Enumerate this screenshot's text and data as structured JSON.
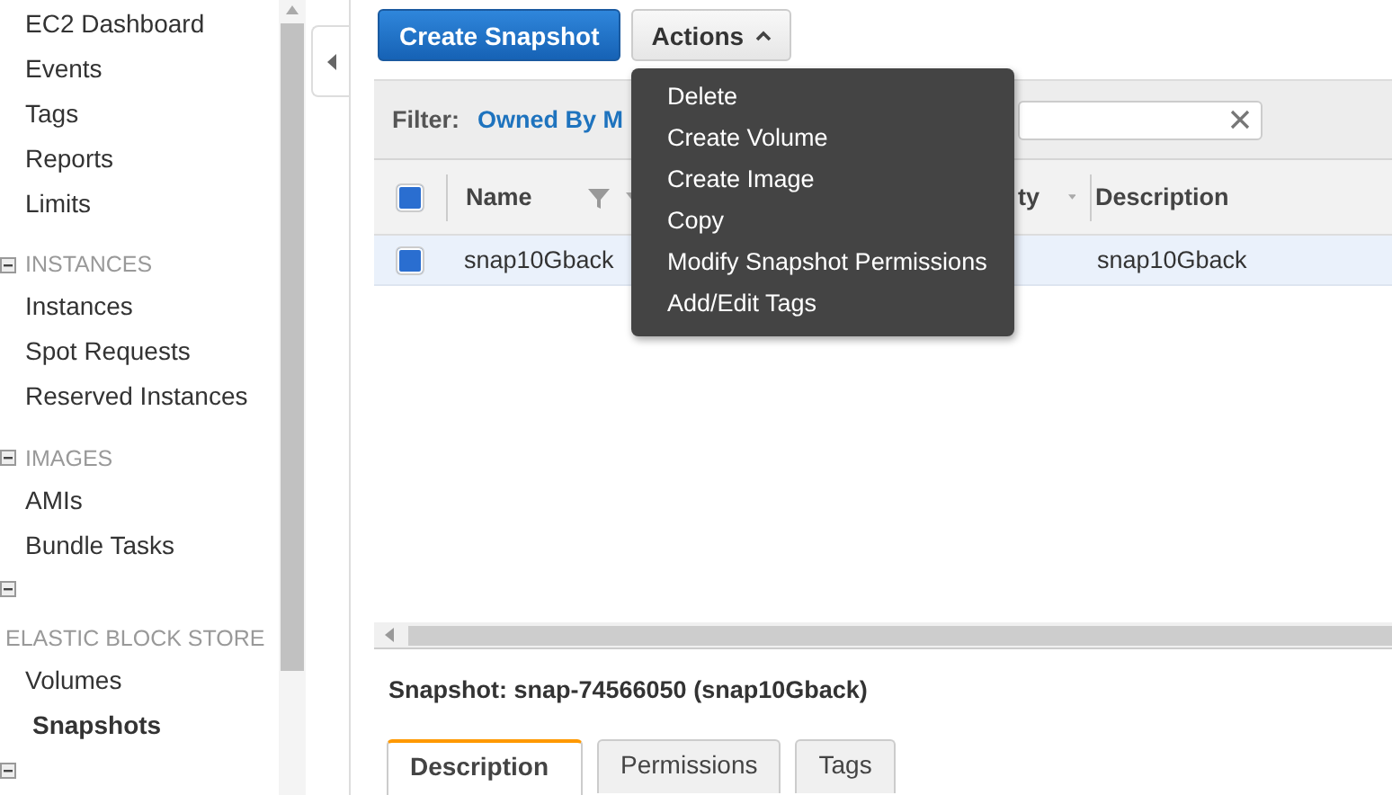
{
  "sidebar": {
    "entries": [
      {
        "kind": "link",
        "label": "EC2 Dashboard",
        "selected": false
      },
      {
        "kind": "link",
        "label": "Events",
        "selected": false
      },
      {
        "kind": "link",
        "label": "Tags",
        "selected": false
      },
      {
        "kind": "link",
        "label": "Reports",
        "selected": false
      },
      {
        "kind": "link",
        "label": "Limits",
        "selected": false
      },
      {
        "kind": "group",
        "label": "INSTANCES"
      },
      {
        "kind": "link",
        "label": "Instances",
        "selected": false
      },
      {
        "kind": "link",
        "label": "Spot Requests",
        "selected": false
      },
      {
        "kind": "link",
        "label": "Reserved Instances",
        "selected": false
      },
      {
        "kind": "group",
        "label": "IMAGES"
      },
      {
        "kind": "link",
        "label": "AMIs",
        "selected": false
      },
      {
        "kind": "link",
        "label": "Bundle Tasks",
        "selected": false
      },
      {
        "kind": "toggle"
      },
      {
        "kind": "heading",
        "label": "ELASTIC BLOCK STORE"
      },
      {
        "kind": "link",
        "label": "Volumes",
        "selected": false
      },
      {
        "kind": "link",
        "label": "Snapshots",
        "selected": true
      },
      {
        "kind": "toggle"
      }
    ]
  },
  "toolbar": {
    "primary_button": "Create Snapshot",
    "actions_button": "Actions",
    "actions_expanded": true
  },
  "actions_menu": [
    "Delete",
    "Create Volume",
    "Create Image",
    "Copy",
    "Modify Snapshot Permissions",
    "Add/Edit Tags"
  ],
  "filter": {
    "label": "Filter:",
    "value": "Owned By M"
  },
  "table": {
    "select_all": true,
    "columns": [
      {
        "label": "Name",
        "kind": "filterable"
      },
      {
        "label": "ty",
        "kind": "sortable"
      },
      {
        "label": "Description",
        "kind": "plain"
      }
    ],
    "rows": [
      {
        "selected": true,
        "name": "snap10Gback",
        "description": "snap10Gback"
      }
    ]
  },
  "details": {
    "title": "Snapshot: snap-74566050 (snap10Gback)",
    "tabs": [
      {
        "label": "Description",
        "selected": true
      },
      {
        "label": "Permissions",
        "selected": false
      },
      {
        "label": "Tags",
        "selected": false
      }
    ]
  }
}
